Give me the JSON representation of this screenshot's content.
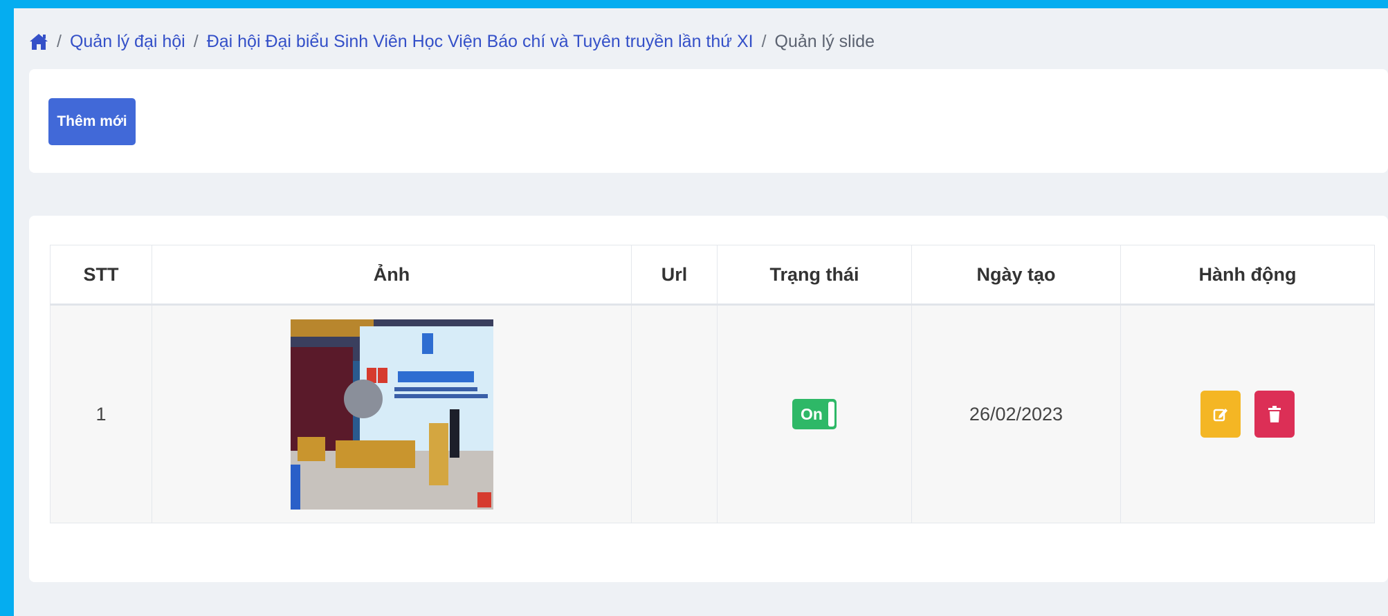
{
  "breadcrumb": {
    "items": [
      "Quản lý đại hội",
      "Đại hội Đại biểu Sinh Viên Học Viện Báo chí và Tuyên truyền lần thứ XI"
    ],
    "current": "Quản lý slide",
    "separator": "/"
  },
  "toolbar": {
    "add_label": "Thêm mới"
  },
  "table": {
    "columns": [
      "STT",
      "Ảnh",
      "Url",
      "Trạng thái",
      "Ngày tạo",
      "Hành động"
    ],
    "rows": [
      {
        "stt": "1",
        "image_icon": "image-thumbnail",
        "url": "",
        "status": "On",
        "created": "26/02/2023"
      }
    ]
  },
  "icons": {
    "home": "home-icon",
    "edit": "edit-icon",
    "delete": "trash-icon"
  },
  "colors": {
    "background": "#05adf0",
    "primary": "#4169d8",
    "toggle_on": "#2eb867",
    "edit": "#f4b624",
    "delete": "#dc2f56"
  }
}
